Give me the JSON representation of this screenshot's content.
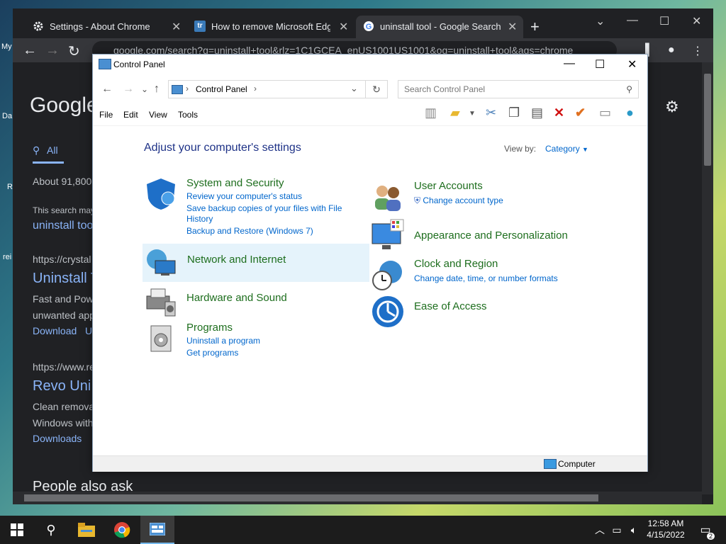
{
  "desktop": {
    "icon_labels": [
      "My",
      "Da",
      "R",
      "rei"
    ]
  },
  "chrome": {
    "tabs": [
      {
        "title": "Settings - About Chrome",
        "icon": "gear-icon"
      },
      {
        "title": "How to remove Microsoft Edge f",
        "icon": "tr-favicon",
        "favicon_text": "tr"
      },
      {
        "title": "uninstall tool - Google Search",
        "icon": "google-icon",
        "active": true
      }
    ],
    "new_tab_label": "+",
    "url": "google.com/search?q=uninstall+tool&rlz=1C1GCEA_enUS1001US1001&oq=uninstall+tool&aqs=chrome",
    "google_page": {
      "logo": "Google",
      "tab_all": "All",
      "results_count": "About 91,800",
      "notice": "This search may",
      "notice_link": "uninstall tool",
      "result1_url": "https://crystal",
      "result1_title": "Uninstall T",
      "result1_line1": "Fast and Pow",
      "result1_line2": "unwanted app",
      "result1_link": "Download",
      "result1_link2": "U",
      "result2_url": "https://www.re",
      "result2_title": "Revo Uni",
      "result2_line1": "Clean remova",
      "result2_line2": "Windows with",
      "result2_link": "Downloads",
      "people_also_ask": "People also ask"
    }
  },
  "control_panel": {
    "title": "Control Panel",
    "breadcrumb": "Control Panel",
    "search_placeholder": "Search Control Panel",
    "menus": [
      "File",
      "Edit",
      "View",
      "Tools"
    ],
    "heading": "Adjust your computer's settings",
    "view_by_label": "View by:",
    "view_by_value": "Category",
    "categories": [
      {
        "title": "System and Security",
        "links": [
          "Review your computer's status",
          "Save backup copies of your files with File",
          "History",
          "Backup and Restore (Windows 7)"
        ]
      },
      {
        "title": "Network and Internet",
        "links": []
      },
      {
        "title": "Hardware and Sound",
        "links": []
      },
      {
        "title": "Programs",
        "links": [
          "Uninstall a program",
          "Get programs"
        ]
      },
      {
        "title": "User Accounts",
        "links": [
          "Change account type"
        ]
      },
      {
        "title": "Appearance and Personalization",
        "links": []
      },
      {
        "title": "Clock and Region",
        "links": [
          "Change date, time, or number formats"
        ]
      },
      {
        "title": "Ease of Access",
        "links": []
      }
    ],
    "status_text": "Computer"
  },
  "taskbar": {
    "time": "12:58 AM",
    "date": "4/15/2022",
    "notification_count": "2"
  }
}
